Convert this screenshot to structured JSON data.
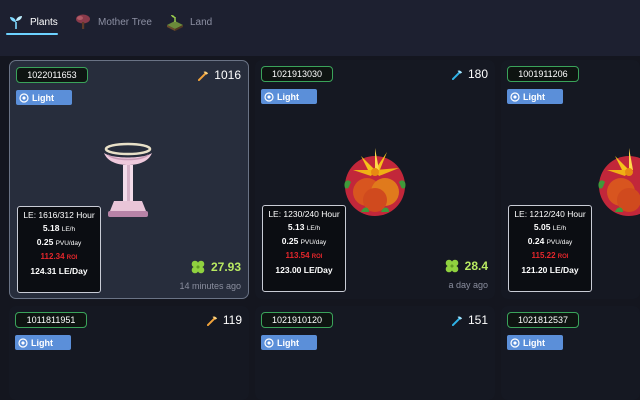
{
  "tabs": [
    {
      "label": "Plants",
      "icon": "sprout-icon",
      "active": true
    },
    {
      "label": "Mother Tree",
      "icon": "tree-icon",
      "active": false
    },
    {
      "label": "Land",
      "icon": "land-icon",
      "active": false
    }
  ],
  "cards": [
    {
      "id": "1022011653",
      "element": "Light",
      "tool": "pickaxe-orange",
      "tool_count": "1016",
      "plant": "pedestal",
      "stats": {
        "le": "LE: 1616/312 Hour",
        "le_rate": "5.18",
        "le_rate_unit": "LE/h",
        "pvu": "0.25",
        "pvu_unit": "PVU/day",
        "roi": "112.34",
        "roi_unit": "ROI",
        "le_day": "124.31 LE/Day"
      },
      "reward": "27.93",
      "time": "14 minutes ago"
    },
    {
      "id": "1021913030",
      "element": "Light",
      "tool": "pickaxe-blue",
      "tool_count": "180",
      "plant": "flower",
      "stats": {
        "le": "LE: 1230/240 Hour",
        "le_rate": "5.13",
        "le_rate_unit": "LE/h",
        "pvu": "0.25",
        "pvu_unit": "PVU/day",
        "roi": "113.54",
        "roi_unit": "ROI",
        "le_day": "123.00 LE/Day"
      },
      "reward": "28.4",
      "time": "a day ago"
    },
    {
      "id": "1001911206",
      "element": "Light",
      "tool": "",
      "tool_count": "",
      "plant": "flower",
      "stats": {
        "le": "LE: 1212/240 Hour",
        "le_rate": "5.05",
        "le_rate_unit": "LE/h",
        "pvu": "0.24",
        "pvu_unit": "PVU/day",
        "roi": "115.22",
        "roi_unit": "ROI",
        "le_day": "121.20 LE/Day"
      },
      "reward": "",
      "time": ""
    },
    {
      "id": "1011811951",
      "element": "Light",
      "tool": "pickaxe-orange",
      "tool_count": "119"
    },
    {
      "id": "1021910120",
      "element": "Light",
      "tool": "pickaxe-blue",
      "tool_count": "151"
    },
    {
      "id": "1021812537",
      "element": "Light",
      "tool": "",
      "tool_count": ""
    }
  ],
  "colors": {
    "accent": "#6dd2ff",
    "id_border": "#3aa35a",
    "light_badge": "#5b8fd9",
    "roi": "#e5262b",
    "reward": "#b9ea62"
  }
}
